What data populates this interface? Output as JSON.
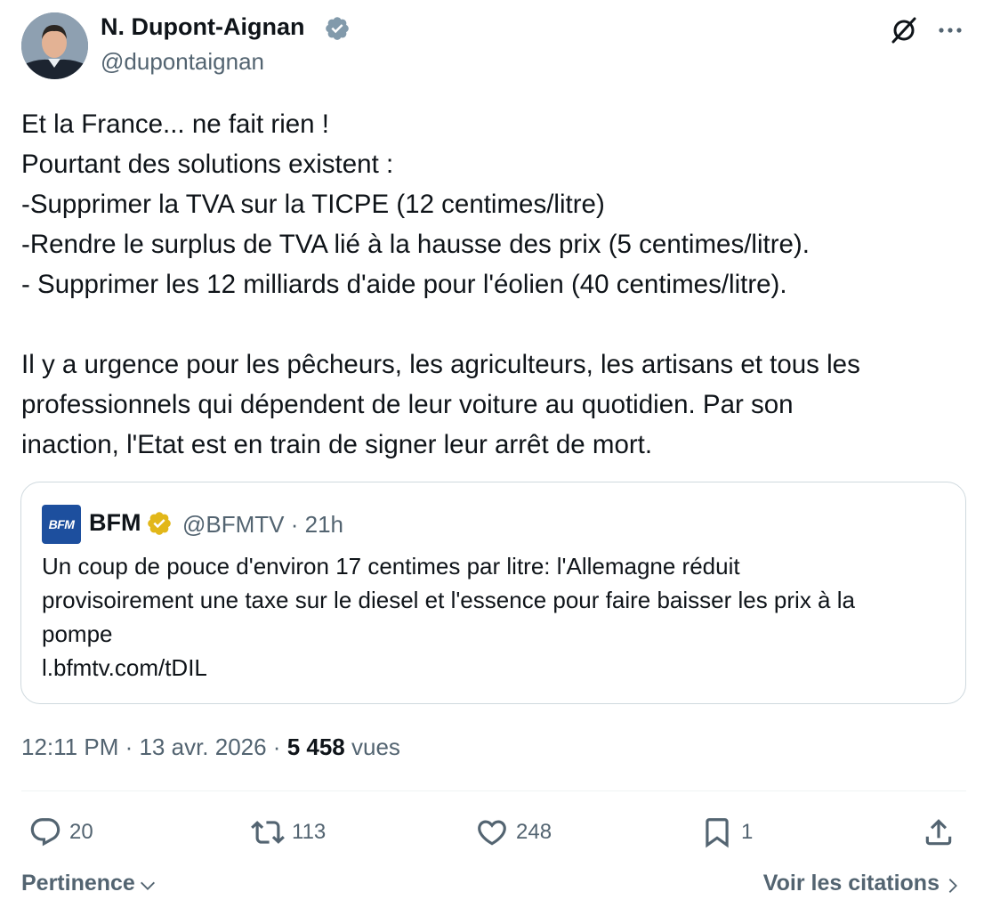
{
  "author": {
    "name": "N. Dupont-Aignan",
    "handle": "@dupontaignan",
    "verified_color": "#829aab"
  },
  "tweet": {
    "lines": [
      "Et la France... ne fait rien !",
      "Pourtant des solutions existent :",
      "-Supprimer la TVA sur la TICPE (12 centimes/litre)",
      "-Rendre le surplus de TVA lié à la hausse des prix (5 centimes/litre).",
      "- Supprimer les 12 milliards d'aide pour l'éolien (40 centimes/litre).",
      "",
      "Il y a urgence pour les pêcheurs, les agriculteurs, les artisans et tous les",
      "professionnels qui dépendent de leur voiture au quotidien. Par son",
      "inaction, l'Etat est en train de signer leur arrêt de mort."
    ]
  },
  "quoted_tweet": {
    "logo_text": "BFM",
    "name": "BFM",
    "meta": "@BFMTV · 21h",
    "verified_color": "#e2b719",
    "lines": [
      "Un coup de pouce d'environ 17 centimes par litre: l'Allemagne réduit",
      "provisoirement une taxe sur le diesel et l'essence pour faire baisser les prix à la",
      "pompe",
      "l.bfmtv.com/tDIL"
    ]
  },
  "meta": {
    "time_date": "12:11 PM · 13 avr. 2026 · ",
    "views_count": "5 458",
    "views_label": " vues"
  },
  "actions": {
    "replies": "20",
    "retweets": "113",
    "likes": "248",
    "bookmarks": "1"
  },
  "footer": {
    "sort_label": "Pertinence",
    "quotes_label": "Voir les citations"
  },
  "icons": {
    "grok": "grok-icon",
    "more": "more-icon",
    "reply": "reply-icon",
    "retweet": "retweet-icon",
    "like": "heart-icon",
    "bookmark": "bookmark-icon",
    "share": "share-icon"
  }
}
